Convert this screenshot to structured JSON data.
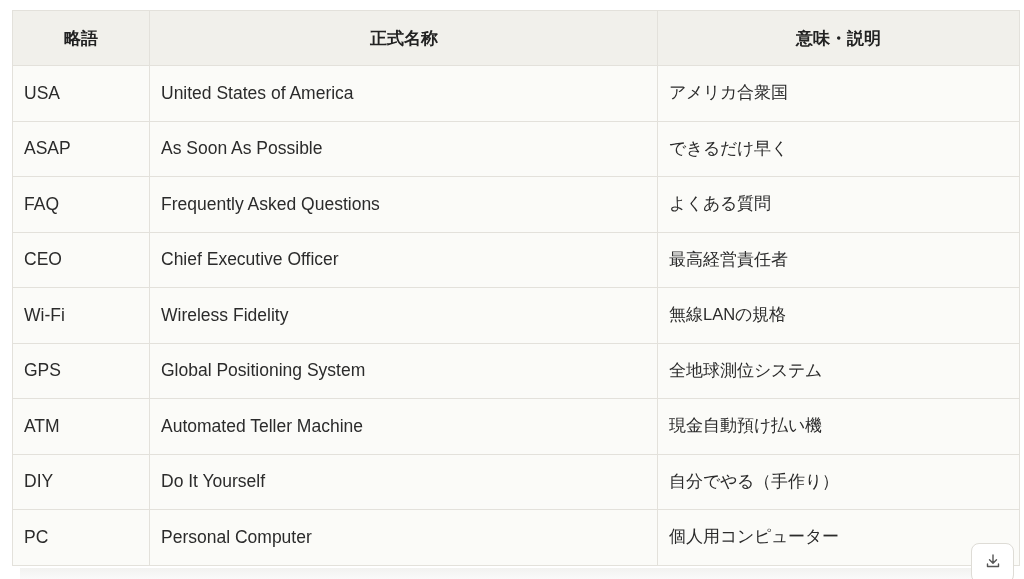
{
  "table": {
    "columns": [
      "略語",
      "正式名称",
      "意味・説明"
    ],
    "rows": [
      [
        "USA",
        "United States of America",
        "アメリカ合衆国"
      ],
      [
        "ASAP",
        "As Soon As Possible",
        "できるだけ早く"
      ],
      [
        "FAQ",
        "Frequently Asked Questions",
        "よくある質問"
      ],
      [
        "CEO",
        "Chief Executive Officer",
        "最高経営責任者"
      ],
      [
        "Wi-Fi",
        "Wireless Fidelity",
        "無線LANの規格"
      ],
      [
        "GPS",
        "Global Positioning System",
        "全地球測位システム"
      ],
      [
        "ATM",
        "Automated Teller Machine",
        "現金自動預け払い機"
      ],
      [
        "DIY",
        "Do It Yourself",
        "自分でやる（手作り）"
      ],
      [
        "PC",
        "Personal Computer",
        "個人用コンピューター"
      ]
    ]
  }
}
